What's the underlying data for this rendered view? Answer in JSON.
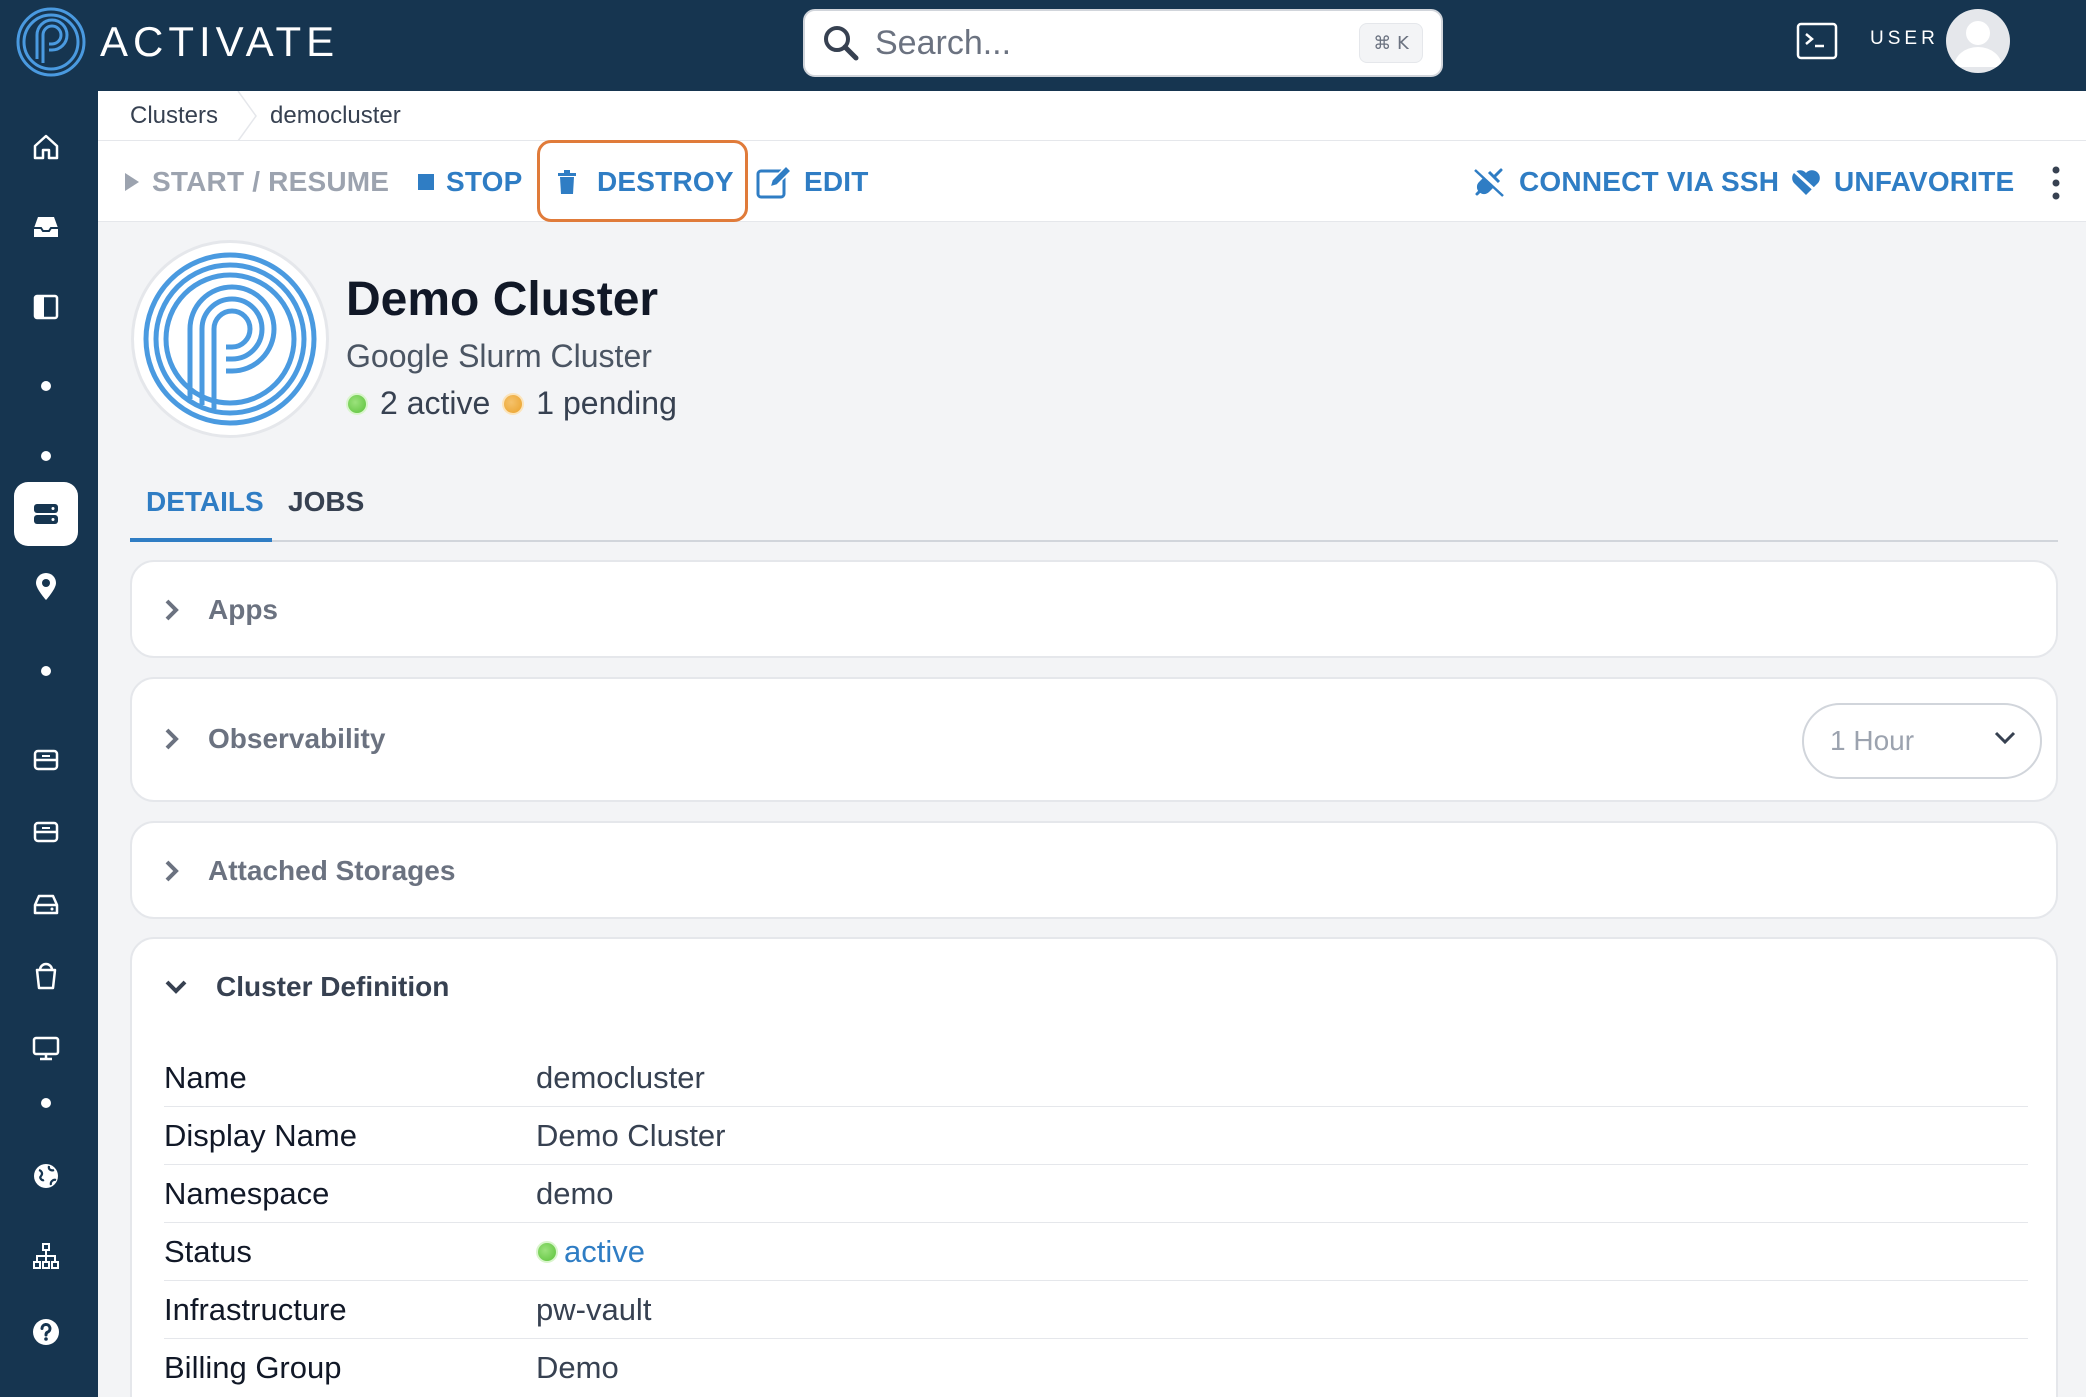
{
  "app": {
    "brand": "ACTIVATE"
  },
  "search": {
    "placeholder": "Search...",
    "shortcut": "⌘ K"
  },
  "user": {
    "label": "USER"
  },
  "breadcrumb": {
    "items": [
      "Clusters",
      "democluster"
    ]
  },
  "toolbar": {
    "start_label": "START / RESUME",
    "stop_label": "STOP",
    "destroy_label": "DESTROY",
    "edit_label": "EDIT",
    "ssh_label": "CONNECT VIA SSH",
    "unfavorite_label": "UNFAVORITE"
  },
  "cluster": {
    "title": "Demo Cluster",
    "subtitle": "Google Slurm Cluster",
    "active_count": "2 active",
    "pending_count": "1 pending"
  },
  "tabs": {
    "details": "DETAILS",
    "jobs": "JOBS"
  },
  "panels": {
    "apps": "Apps",
    "observability": "Observability",
    "observability_range": "1 Hour",
    "storages": "Attached Storages",
    "definition": "Cluster Definition"
  },
  "definition": {
    "rows": [
      {
        "label": "Name",
        "value": "democluster"
      },
      {
        "label": "Display Name",
        "value": "Demo Cluster"
      },
      {
        "label": "Namespace",
        "value": "demo"
      },
      {
        "label": "Status",
        "value": "active"
      },
      {
        "label": "Infrastructure",
        "value": "pw-vault"
      },
      {
        "label": "Billing Group",
        "value": "Demo"
      }
    ]
  },
  "colors": {
    "nav_bg": "#163550",
    "accent": "#2f7dc4",
    "highlight": "#e07b3a",
    "status_active": "#5bc23a",
    "status_pending": "#eaa12a"
  }
}
